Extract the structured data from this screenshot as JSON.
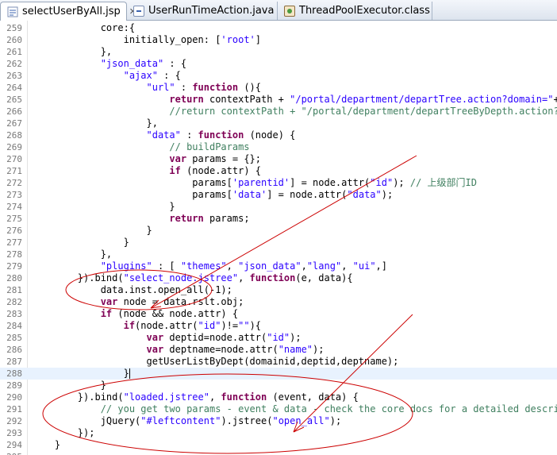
{
  "tabs": [
    {
      "label": "selectUserByAll.jsp",
      "icon": "jsp-file-icon",
      "close": "✕"
    },
    {
      "label": "UserRunTimeAction.java",
      "icon": "java-file-icon"
    },
    {
      "label": "ThreadPoolExecutor.class",
      "icon": "class-file-icon"
    }
  ],
  "annotation_color": "#cc0000",
  "lines": [
    {
      "n": "259",
      "parts": [
        [
          "",
          "            core:{"
        ]
      ]
    },
    {
      "n": "260",
      "parts": [
        [
          "",
          "                initially_open: ["
        ],
        [
          "str",
          "'root'"
        ],
        [
          "",
          "]"
        ]
      ]
    },
    {
      "n": "261",
      "parts": [
        [
          "",
          "            },"
        ]
      ]
    },
    {
      "n": "262",
      "parts": [
        [
          "",
          "            "
        ],
        [
          "str",
          "\"json_data\""
        ],
        [
          "",
          " : {"
        ]
      ]
    },
    {
      "n": "263",
      "parts": [
        [
          "",
          "                "
        ],
        [
          "str",
          "\"ajax\""
        ],
        [
          "",
          " : {"
        ]
      ]
    },
    {
      "n": "264",
      "parts": [
        [
          "",
          "                    "
        ],
        [
          "str",
          "\"url\""
        ],
        [
          "",
          " : "
        ],
        [
          "kw",
          "function"
        ],
        [
          "",
          " (){"
        ]
      ]
    },
    {
      "n": "265",
      "parts": [
        [
          "",
          "                        "
        ],
        [
          "kw",
          "return"
        ],
        [
          "",
          " contextPath + "
        ],
        [
          "str",
          "\"/portal/department/departTree.action?domain=\""
        ],
        [
          "",
          "+dom"
        ]
      ]
    },
    {
      "n": "266",
      "parts": [
        [
          "",
          "                        "
        ],
        [
          "cm",
          "//return contextPath + \"/portal/department/departTreeByDepth.action?dom"
        ]
      ]
    },
    {
      "n": "267",
      "parts": [
        [
          "",
          "                    },"
        ]
      ]
    },
    {
      "n": "268",
      "parts": [
        [
          "",
          "                    "
        ],
        [
          "str",
          "\"data\""
        ],
        [
          "",
          " : "
        ],
        [
          "kw",
          "function"
        ],
        [
          "",
          " (node) {"
        ]
      ]
    },
    {
      "n": "269",
      "parts": [
        [
          "",
          "                        "
        ],
        [
          "cm",
          "// buildParams"
        ]
      ]
    },
    {
      "n": "270",
      "parts": [
        [
          "",
          "                        "
        ],
        [
          "kw",
          "var"
        ],
        [
          "",
          " params = {};"
        ]
      ]
    },
    {
      "n": "271",
      "parts": [
        [
          "",
          "                        "
        ],
        [
          "kw",
          "if"
        ],
        [
          "",
          " (node.attr) {"
        ]
      ]
    },
    {
      "n": "272",
      "parts": [
        [
          "",
          "                            params["
        ],
        [
          "str",
          "'parentid'"
        ],
        [
          "",
          "] = node.attr("
        ],
        [
          "str",
          "\"id\""
        ],
        [
          "",
          "); "
        ],
        [
          "cm",
          "// 上级部门ID"
        ]
      ]
    },
    {
      "n": "273",
      "parts": [
        [
          "",
          "                            params["
        ],
        [
          "str",
          "'data'"
        ],
        [
          "",
          "] = node.attr("
        ],
        [
          "str",
          "\"data\""
        ],
        [
          "",
          ");"
        ]
      ]
    },
    {
      "n": "274",
      "parts": [
        [
          "",
          "                        }"
        ]
      ]
    },
    {
      "n": "275",
      "parts": [
        [
          "",
          "                        "
        ],
        [
          "kw",
          "return"
        ],
        [
          "",
          " params;"
        ]
      ]
    },
    {
      "n": "276",
      "parts": [
        [
          "",
          "                    }"
        ]
      ]
    },
    {
      "n": "277",
      "parts": [
        [
          "",
          "                }"
        ]
      ]
    },
    {
      "n": "278",
      "parts": [
        [
          "",
          "            },"
        ]
      ]
    },
    {
      "n": "279",
      "parts": [
        [
          "",
          "            "
        ],
        [
          "str",
          "\"plugins\""
        ],
        [
          "",
          " : [ "
        ],
        [
          "str",
          "\"themes\""
        ],
        [
          "",
          ", "
        ],
        [
          "str",
          "\"json_data\""
        ],
        [
          "",
          ","
        ],
        [
          "str",
          "\"lang\""
        ],
        [
          "",
          ", "
        ],
        [
          "str",
          "\"ui\""
        ],
        [
          "",
          ",]"
        ]
      ]
    },
    {
      "n": "280",
      "parts": [
        [
          "",
          "        }).bind("
        ],
        [
          "str",
          "\"select_node.jstree\""
        ],
        [
          "",
          ", "
        ],
        [
          "kw",
          "function"
        ],
        [
          "",
          "(e, data){"
        ]
      ]
    },
    {
      "n": "281",
      "parts": [
        [
          "",
          "            data.inst.open_all(-1);"
        ]
      ]
    },
    {
      "n": "282",
      "parts": [
        [
          "",
          "            "
        ],
        [
          "kw",
          "var"
        ],
        [
          "",
          " node = data.rslt.obj;"
        ]
      ]
    },
    {
      "n": "283",
      "parts": [
        [
          "",
          "            "
        ],
        [
          "kw",
          "if"
        ],
        [
          "",
          " (node && node.attr) {"
        ]
      ]
    },
    {
      "n": "284",
      "parts": [
        [
          "",
          "                "
        ],
        [
          "kw",
          "if"
        ],
        [
          "",
          "(node.attr("
        ],
        [
          "str",
          "\"id\""
        ],
        [
          "",
          ")!="
        ],
        [
          "str",
          "\"\""
        ],
        [
          "",
          "){"
        ]
      ]
    },
    {
      "n": "285",
      "parts": [
        [
          "",
          "                    "
        ],
        [
          "kw",
          "var"
        ],
        [
          "",
          " deptid=node.attr("
        ],
        [
          "str",
          "\"id\""
        ],
        [
          "",
          ");"
        ]
      ]
    },
    {
      "n": "286",
      "parts": [
        [
          "",
          "                    "
        ],
        [
          "kw",
          "var"
        ],
        [
          "",
          " deptname=node.attr("
        ],
        [
          "str",
          "\"name\""
        ],
        [
          "",
          ");"
        ]
      ]
    },
    {
      "n": "287",
      "parts": [
        [
          "",
          "                    getUserListByDept(domainid,deptid,deptname);"
        ]
      ]
    },
    {
      "n": "288",
      "parts": [
        [
          "",
          "                }"
        ]
      ],
      "current": true
    },
    {
      "n": "289",
      "parts": [
        [
          "",
          "            }"
        ]
      ]
    },
    {
      "n": "290",
      "parts": [
        [
          "",
          "        }).bind("
        ],
        [
          "str",
          "\"loaded.jstree\""
        ],
        [
          "",
          ", "
        ],
        [
          "kw",
          "function"
        ],
        [
          "",
          " (event, data) {"
        ]
      ]
    },
    {
      "n": "291",
      "parts": [
        [
          "",
          "            "
        ],
        [
          "cm",
          "// you get two params - event & data - check the core docs for a detailed descripti"
        ]
      ]
    },
    {
      "n": "292",
      "parts": [
        [
          "",
          "            jQuery("
        ],
        [
          "str",
          "\"#leftcontent\""
        ],
        [
          "",
          ").jstree("
        ],
        [
          "str",
          "\"open_all\""
        ],
        [
          "",
          ");"
        ]
      ]
    },
    {
      "n": "293",
      "parts": [
        [
          "",
          "        });"
        ]
      ]
    },
    {
      "n": "294",
      "parts": [
        [
          "",
          "    }"
        ]
      ]
    },
    {
      "n": "295",
      "parts": [
        [
          "",
          ""
        ]
      ]
    }
  ]
}
